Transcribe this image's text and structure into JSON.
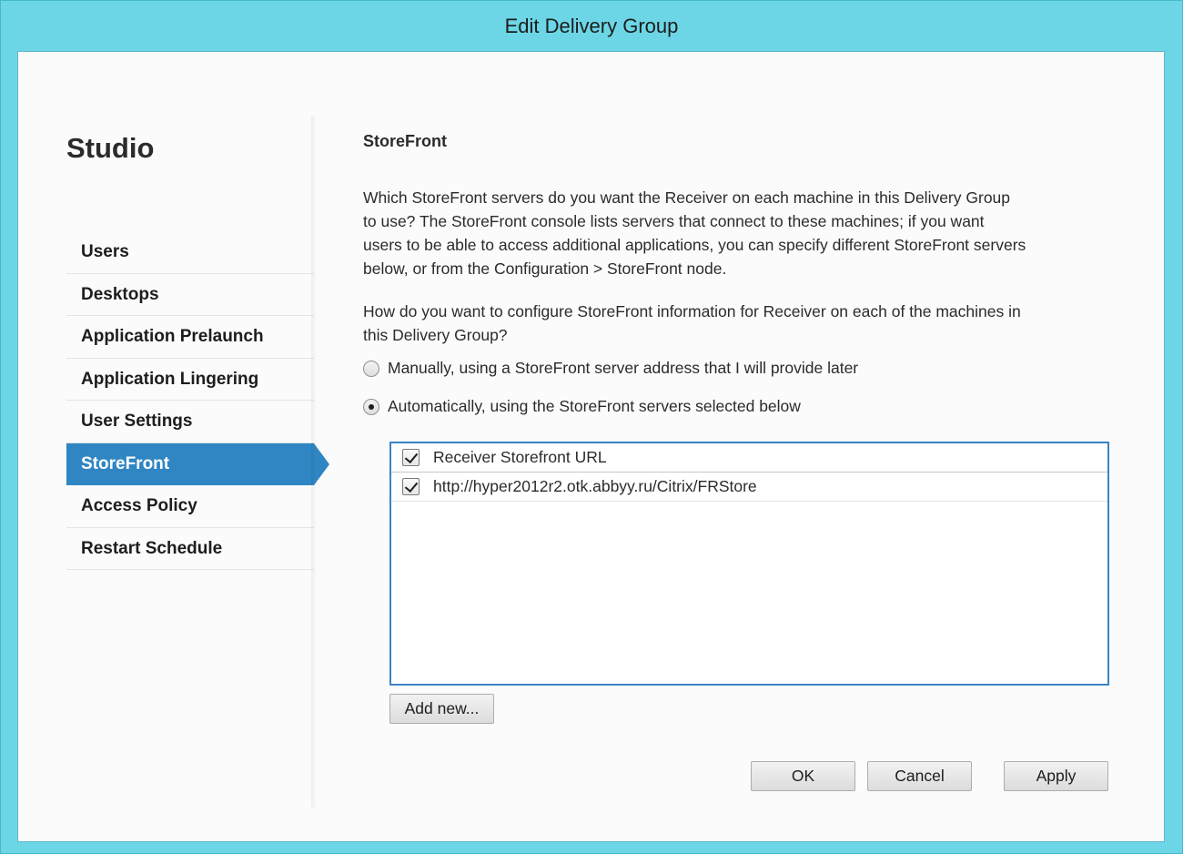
{
  "window": {
    "title": "Edit Delivery Group"
  },
  "sidebar": {
    "app_title": "Studio",
    "items": [
      {
        "label": "Users"
      },
      {
        "label": "Desktops"
      },
      {
        "label": "Application Prelaunch"
      },
      {
        "label": "Application Lingering"
      },
      {
        "label": "User Settings"
      },
      {
        "label": "StoreFront",
        "active": true
      },
      {
        "label": "Access Policy"
      },
      {
        "label": "Restart Schedule"
      }
    ]
  },
  "main": {
    "section_title": "StoreFront",
    "description": "Which StoreFront servers do you want the Receiver on each machine in this Delivery Group to use? The StoreFront console lists servers that connect to these machines; if you want users to be able to access additional applications, you can specify different StoreFront servers below, or from the Configuration > StoreFront node.",
    "question": "How do you want to configure StoreFront information for Receiver on each of the machines in this Delivery Group?",
    "options": [
      {
        "label": "Manually, using a StoreFront server address that I will provide later",
        "selected": false
      },
      {
        "label": "Automatically, using the StoreFront servers selected below",
        "selected": true
      }
    ],
    "list": {
      "header": {
        "label": "Receiver Storefront URL",
        "checked": true
      },
      "rows": [
        {
          "url": "http://hyper2012r2.otk.abbyy.ru/Citrix/FRStore",
          "checked": true
        }
      ]
    },
    "add_button": "Add new..."
  },
  "footer": {
    "ok": "OK",
    "cancel": "Cancel",
    "apply": "Apply"
  },
  "colors": {
    "titlebar": "#6cd6e6",
    "accent": "#2f86c3",
    "list_border": "#3a84c4"
  }
}
